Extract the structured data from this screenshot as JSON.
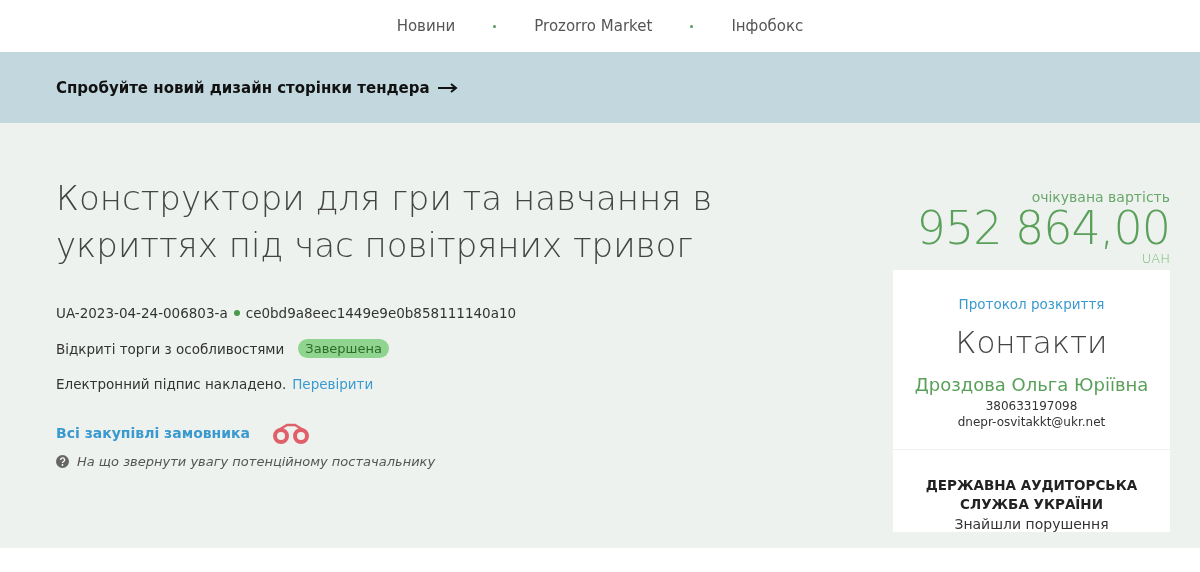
{
  "nav": {
    "items": [
      "Новини",
      "Prozorro Market",
      "Інфобокс"
    ]
  },
  "banner": {
    "text": "Спробуйте новий дизайн сторінки тендера"
  },
  "tender": {
    "title": "Конструктори для гри та навчання в укриттях під час повітряних тривог",
    "id": "UA-2023-04-24-006803-a",
    "hash": "ce0bd9a8eec1449e9e0b858111140a10",
    "procedure": "Відкриті торги з особливостями",
    "status": "Завершена",
    "signature": "Електронний підпис накладено.",
    "signature_link": "Перевірити",
    "buyer_link": "Всі закупівлі замовника",
    "hint": "На що звернути увагу потенційному постачальнику"
  },
  "value": {
    "label": "очікувана вартість",
    "amount": "952 864,00",
    "currency": "UAH"
  },
  "contacts": {
    "protocol_link": "Протокол розкриття",
    "title": "Контакти",
    "name": "Дроздова Ольга Юріївна",
    "phone": "380633197098",
    "email": "dnepr-osvitakkt@ukr.net"
  },
  "audit": {
    "title": "ДЕРЖАВНА АУДИТОРСЬКА СЛУЖБА УКРАЇНИ",
    "text": "Знайшли порушення"
  }
}
